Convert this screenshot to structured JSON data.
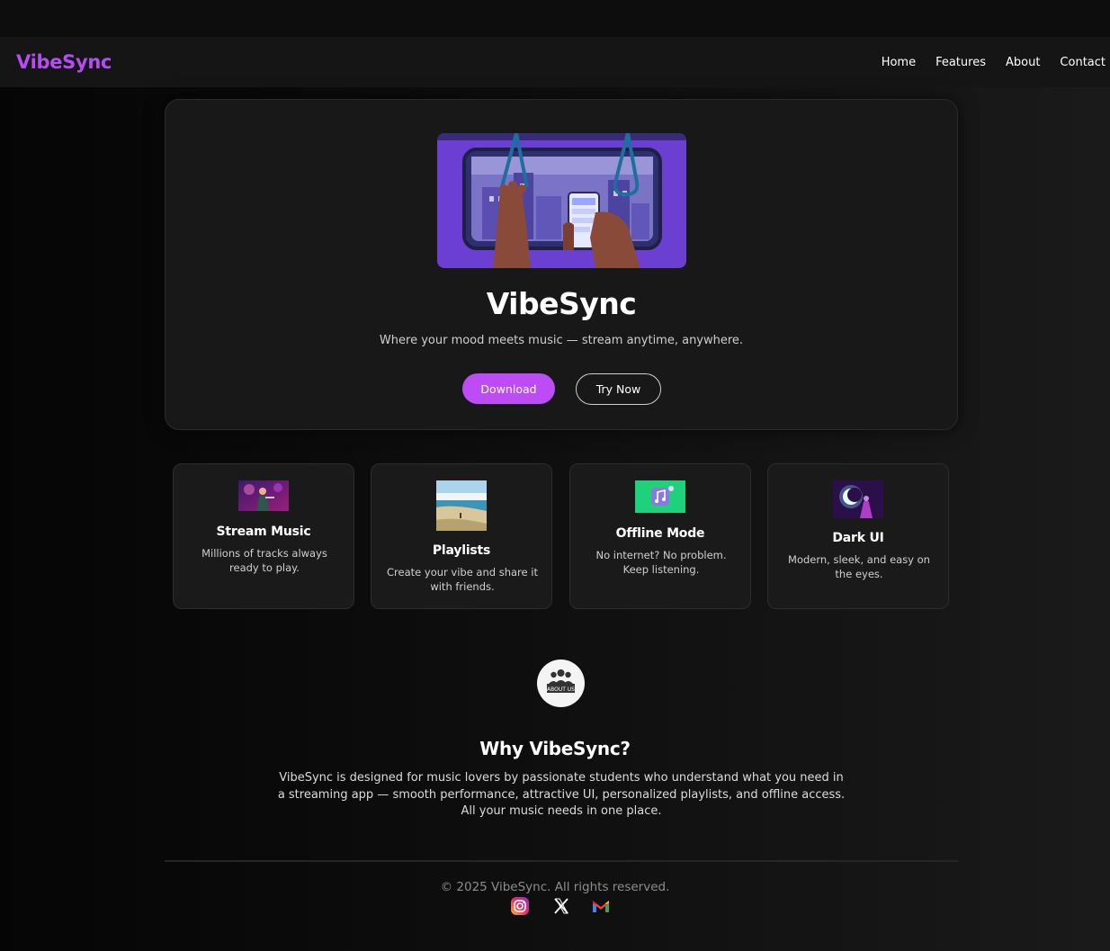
{
  "navbar": {
    "logo": "VibeSync",
    "links": [
      "Home",
      "Features",
      "About",
      "Contact"
    ]
  },
  "hero": {
    "title": "VibeSync",
    "subtitle": "Where your mood meets music — stream anytime, anywhere.",
    "download_label": "Download",
    "try_label": "Try Now"
  },
  "features": [
    {
      "title": "Stream Music",
      "desc": "Millions of tracks always ready to play.",
      "image": "concert-image"
    },
    {
      "title": "Playlists",
      "desc": "Create your vibe and share it with friends.",
      "image": "beach-image"
    },
    {
      "title": "Offline Mode",
      "desc": "No internet? No problem. Keep listening.",
      "image": "music-note-icon"
    },
    {
      "title": "Dark UI",
      "desc": "Modern, sleek, and easy on the eyes.",
      "image": "moon-night-image"
    }
  ],
  "about": {
    "badge_text": "ABOUT US",
    "title": "Why VibeSync?",
    "text": "VibeSync is designed for music lovers by passionate students who understand what you need in a streaming app — smooth performance, attractive UI, personalized playlists, and offline access. All your music needs in one place."
  },
  "footer": {
    "copyright": "© 2025 VibeSync. All rights reserved.",
    "socials": [
      "instagram-icon",
      "x-icon",
      "gmail-icon"
    ]
  },
  "colors": {
    "accent": "#bd4cf7",
    "logo": "#b74cf5",
    "background": "#0e0e0e",
    "card": "#1a1a1a"
  }
}
